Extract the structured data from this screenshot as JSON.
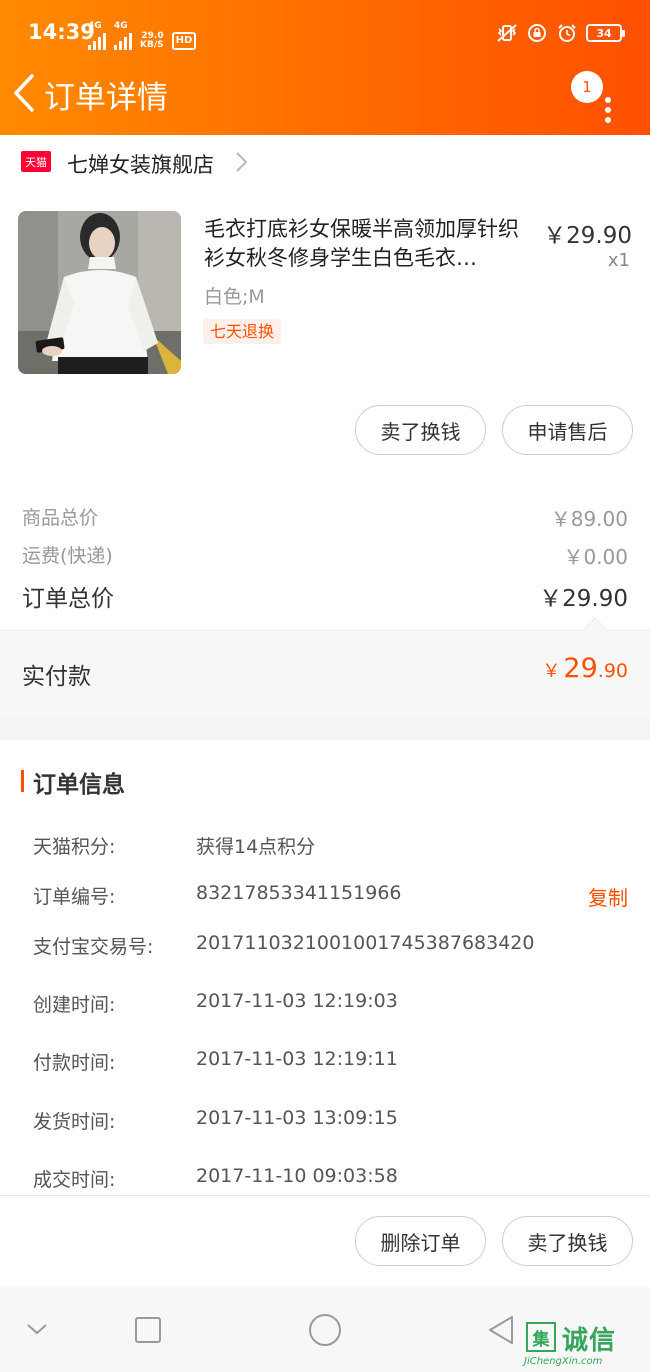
{
  "status_bar": {
    "time": "14:39",
    "network_1": "4G",
    "network_2": "4G",
    "speed_value": "29.0",
    "speed_unit": "KB/S",
    "hd_label": "HD",
    "battery": "34"
  },
  "header": {
    "title": "订单详情",
    "message_badge": "1"
  },
  "shop": {
    "badge": "天猫",
    "name": "七婵女装旗舰店"
  },
  "product": {
    "title": "毛衣打底衫女保暖半高领加厚针织衫女秋冬修身学生白色毛衣…",
    "price": "￥29.90",
    "quantity": "x1",
    "sku": "白色;M",
    "tag": "七天退换"
  },
  "item_actions": {
    "sell_label": "卖了换钱",
    "after_sale_label": "申请售后"
  },
  "summary": {
    "goods_total_label": "商品总价",
    "goods_total_value": "￥89.00",
    "shipping_label": "运费(快递)",
    "shipping_value": "￥0.00",
    "order_total_label": "订单总价",
    "order_total_value": "￥29.90"
  },
  "paid": {
    "label": "实付款",
    "currency": "￥",
    "integer": "29",
    "decimal": ".90"
  },
  "order_info": {
    "title": "订单信息",
    "copy_label": "复制",
    "rows": [
      {
        "key": "天猫积分:",
        "value": "获得14点积分"
      },
      {
        "key": "订单编号:",
        "value": "83217853341151966"
      },
      {
        "key": "支付宝交易号:",
        "value": "2017110321001001745387683420"
      },
      {
        "key": "创建时间:",
        "value": "2017-11-03 12:19:03"
      },
      {
        "key": "付款时间:",
        "value": "2017-11-03 12:19:11"
      },
      {
        "key": "发货时间:",
        "value": "2017-11-03 13:09:15"
      },
      {
        "key": "成交时间:",
        "value": "2017-11-10 09:03:58"
      }
    ]
  },
  "footer_actions": {
    "delete_label": "删除订单",
    "sell_label": "卖了换钱"
  },
  "watermark": {
    "mark": "集",
    "text": "诚信",
    "url": "JiChengXin.com"
  },
  "colors": {
    "accent": "#ff5000",
    "header_start": "#ff8a00",
    "header_end": "#ff5000",
    "tmall_red": "#ff0036",
    "watermark_green": "#37a65b"
  }
}
